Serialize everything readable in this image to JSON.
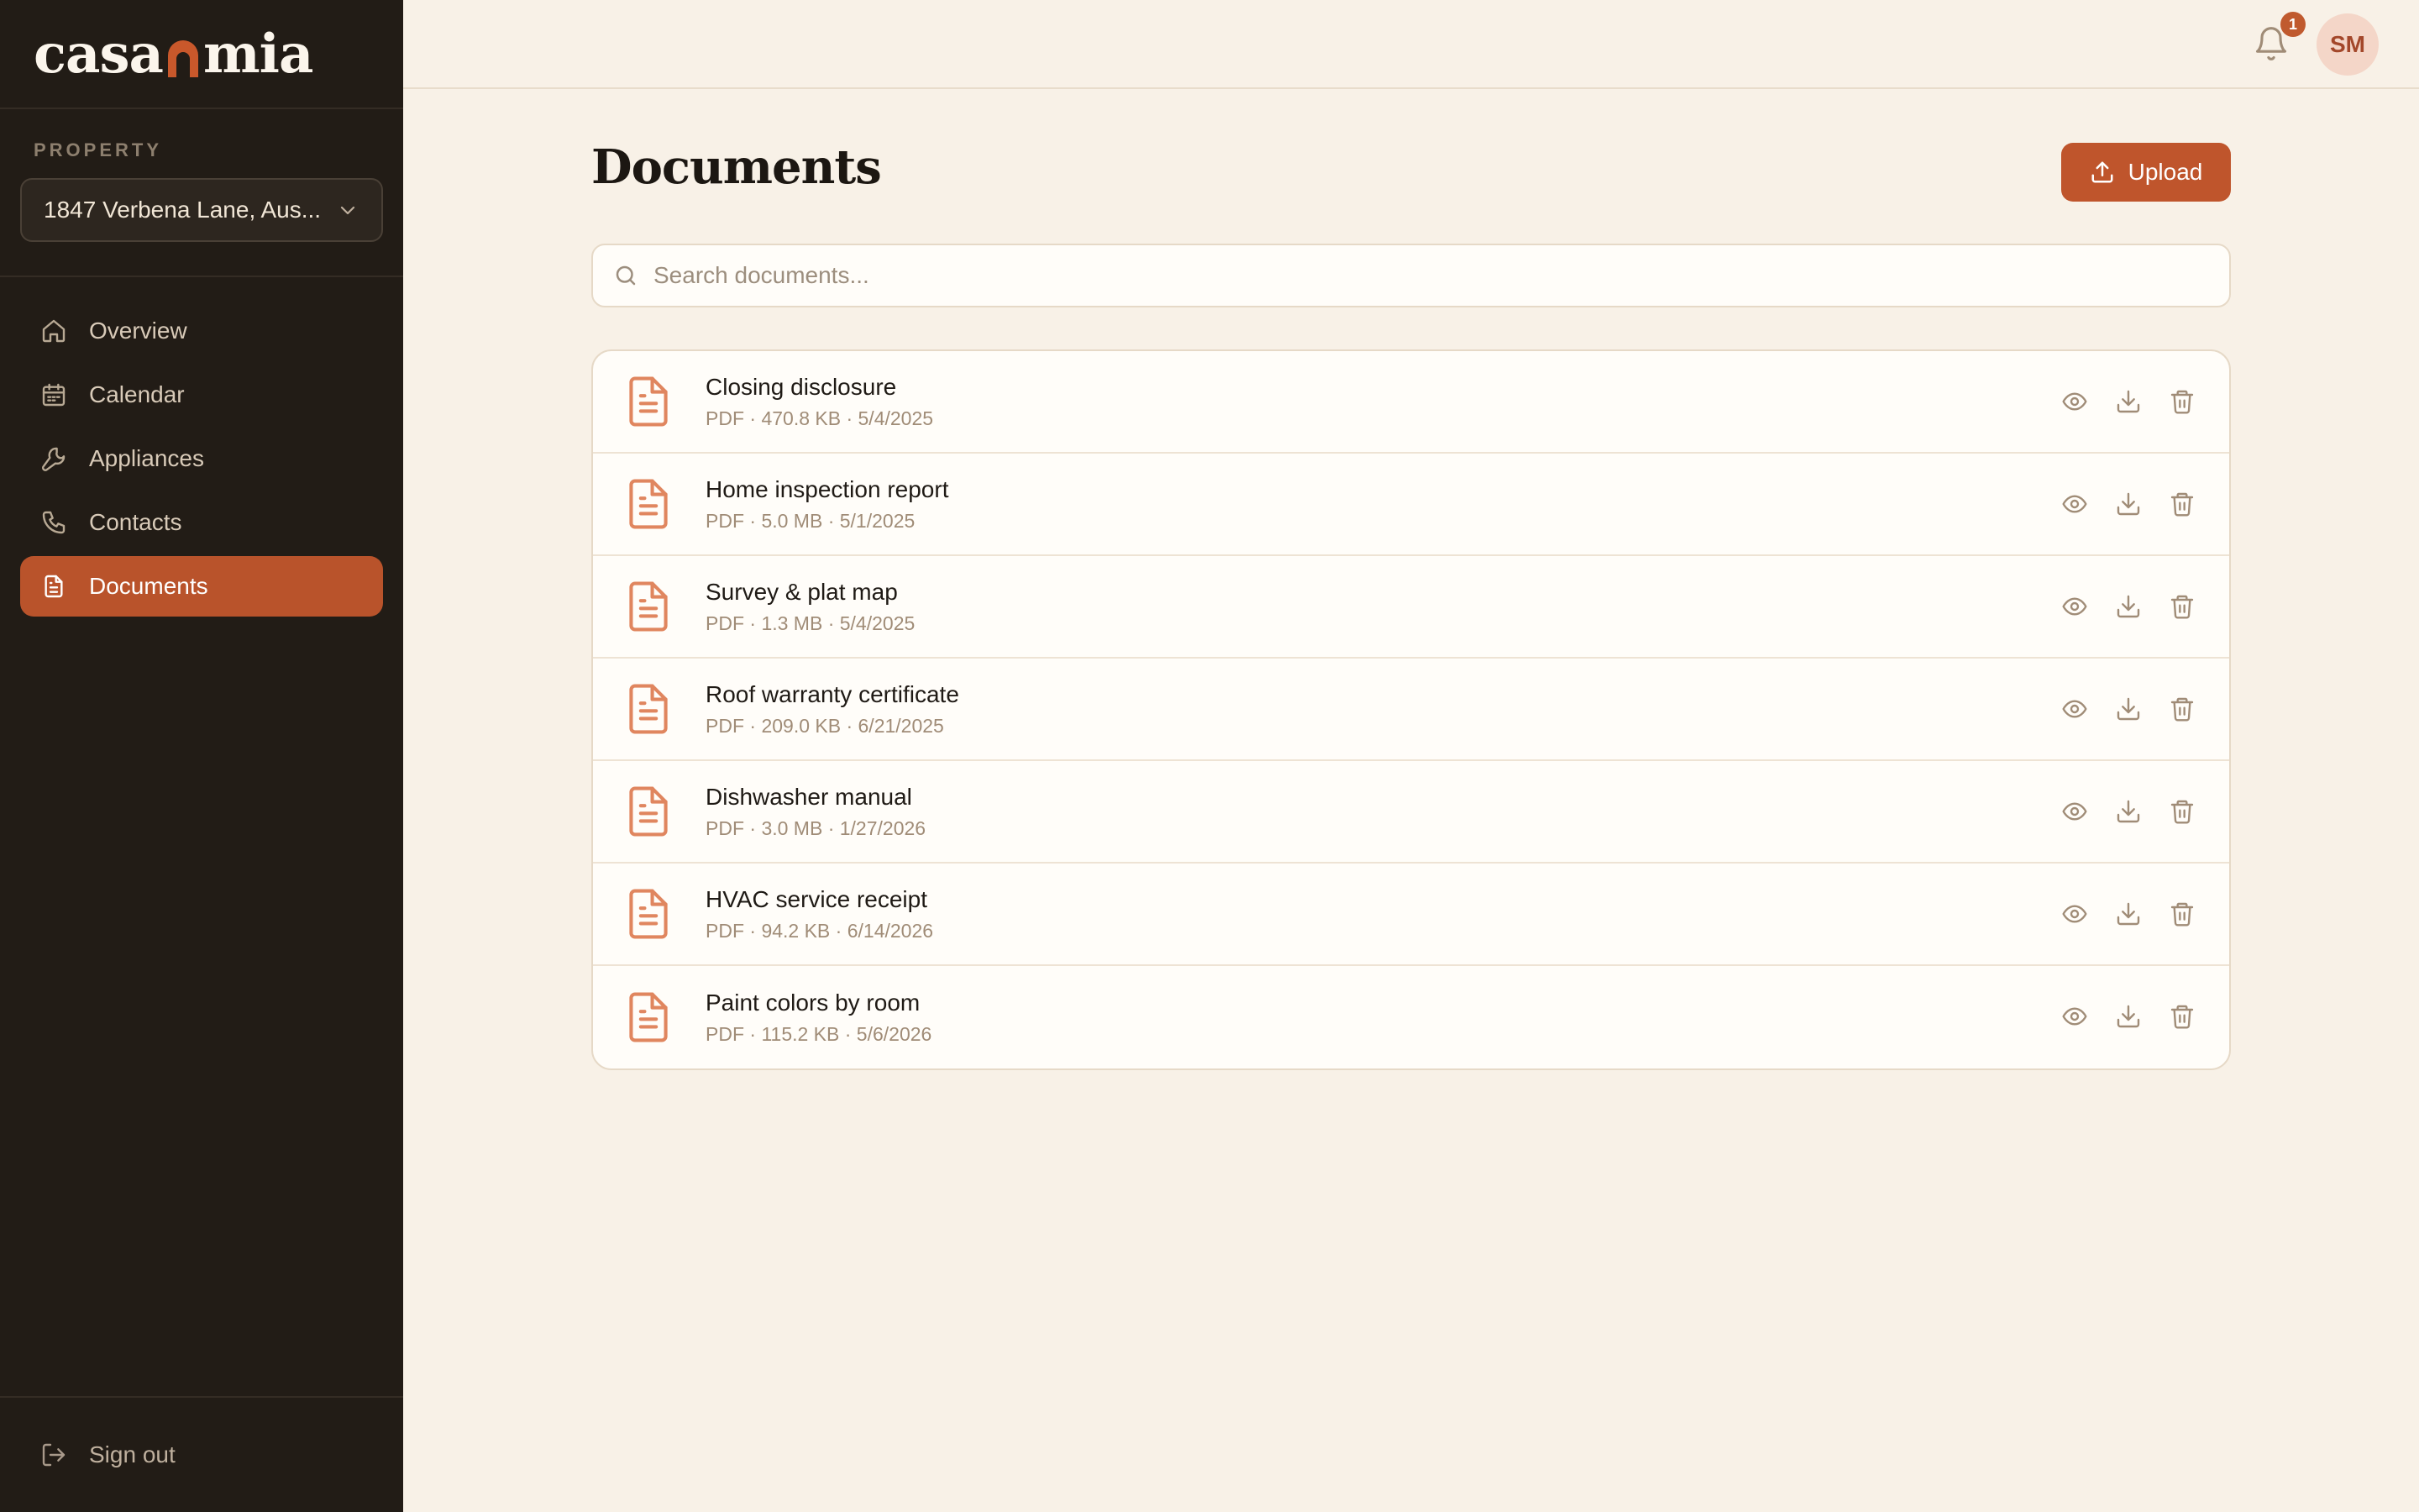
{
  "app": {
    "logo_left": "casa",
    "logo_right": "mia"
  },
  "sidebar": {
    "property_heading": "PROPERTY",
    "property_selected": "1847 Verbena Lane, Aus...",
    "items": [
      {
        "label": "Overview",
        "icon": "home-icon"
      },
      {
        "label": "Calendar",
        "icon": "calendar-icon"
      },
      {
        "label": "Appliances",
        "icon": "wrench-icon"
      },
      {
        "label": "Contacts",
        "icon": "phone-icon"
      },
      {
        "label": "Documents",
        "icon": "document-icon",
        "active": true
      }
    ],
    "signout_label": "Sign out"
  },
  "topbar": {
    "notification_count": "1",
    "avatar_initials": "SM"
  },
  "main": {
    "title": "Documents",
    "upload_label": "Upload",
    "search_placeholder": "Search documents...",
    "documents": [
      {
        "name": "Closing disclosure",
        "meta": "PDF · 470.8 KB · 5/4/2025"
      },
      {
        "name": "Home inspection report",
        "meta": "PDF · 5.0 MB · 5/1/2025"
      },
      {
        "name": "Survey & plat map",
        "meta": "PDF · 1.3 MB · 5/4/2025"
      },
      {
        "name": "Roof warranty certificate",
        "meta": "PDF · 209.0 KB · 6/21/2025"
      },
      {
        "name": "Dishwasher manual",
        "meta": "PDF · 3.0 MB · 1/27/2026"
      },
      {
        "name": "HVAC service receipt",
        "meta": "PDF · 94.2 KB · 6/14/2026"
      },
      {
        "name": "Paint colors by room",
        "meta": "PDF · 115.2 KB · 5/6/2026"
      }
    ]
  },
  "colors": {
    "accent": "#bf552c",
    "sidebar_bg": "#221c16",
    "page_bg": "#f8f1e7",
    "doc_icon": "#e0865f"
  }
}
